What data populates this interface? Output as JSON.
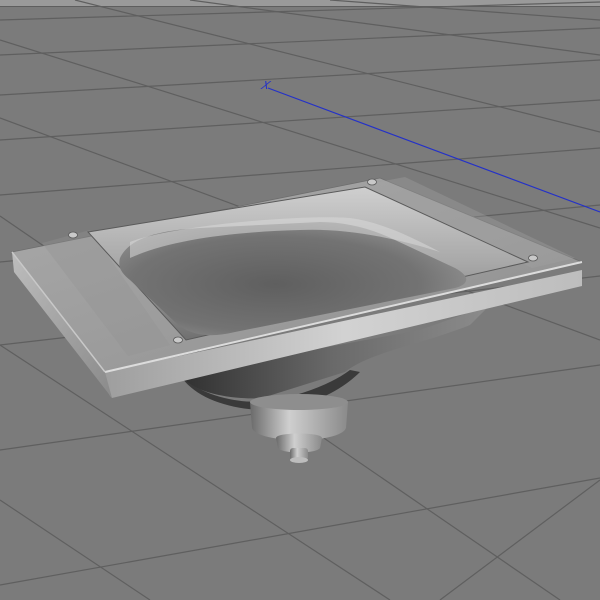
{
  "viewport": {
    "background_color": "#7b7b7b",
    "grid_line_color": "#5f5f5f",
    "axis_color": "#2431c8"
  },
  "axis": {
    "label": "X"
  },
  "model": {
    "object": "sink basin",
    "base_color": "#8c8c8c",
    "highlight_color": "#cfcfcf",
    "shadow_color": "#3d3d3d"
  }
}
